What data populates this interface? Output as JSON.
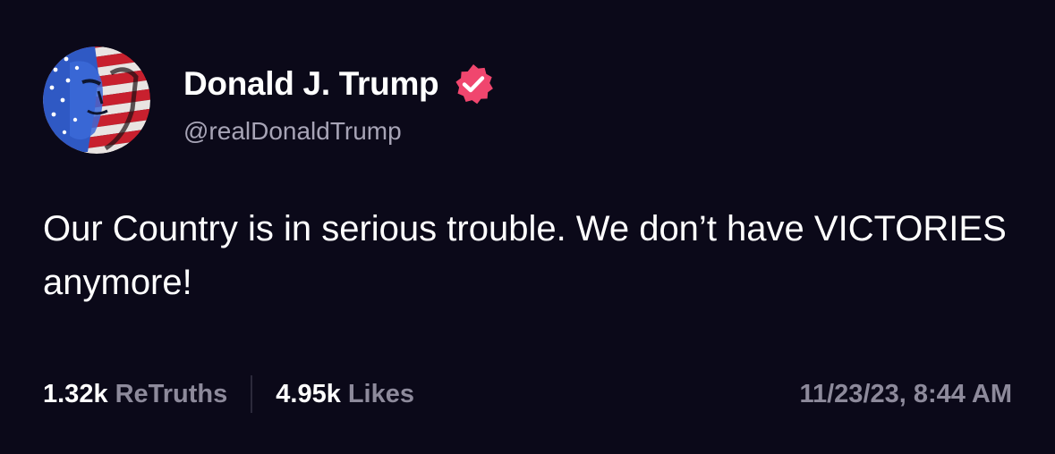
{
  "author": {
    "display_name": "Donald J. Trump",
    "handle": "@realDonaldTrump",
    "verified": true,
    "avatar_icon": "flag-portrait-avatar",
    "verified_icon": "verified-badge-icon"
  },
  "post": {
    "text": "Our Country is in serious trouble. We don’t have VICTORIES anymore!"
  },
  "stats": {
    "retruths_count": "1.32k",
    "retruths_label": "ReTruths",
    "likes_count": "4.95k",
    "likes_label": "Likes",
    "timestamp": "11/23/23, 8:44 AM"
  },
  "colors": {
    "background": "#0b0919",
    "text_primary": "#ffffff",
    "text_secondary": "#a7a4b6",
    "text_muted": "#8d8a9b",
    "verified_badge": "#f0466e"
  }
}
